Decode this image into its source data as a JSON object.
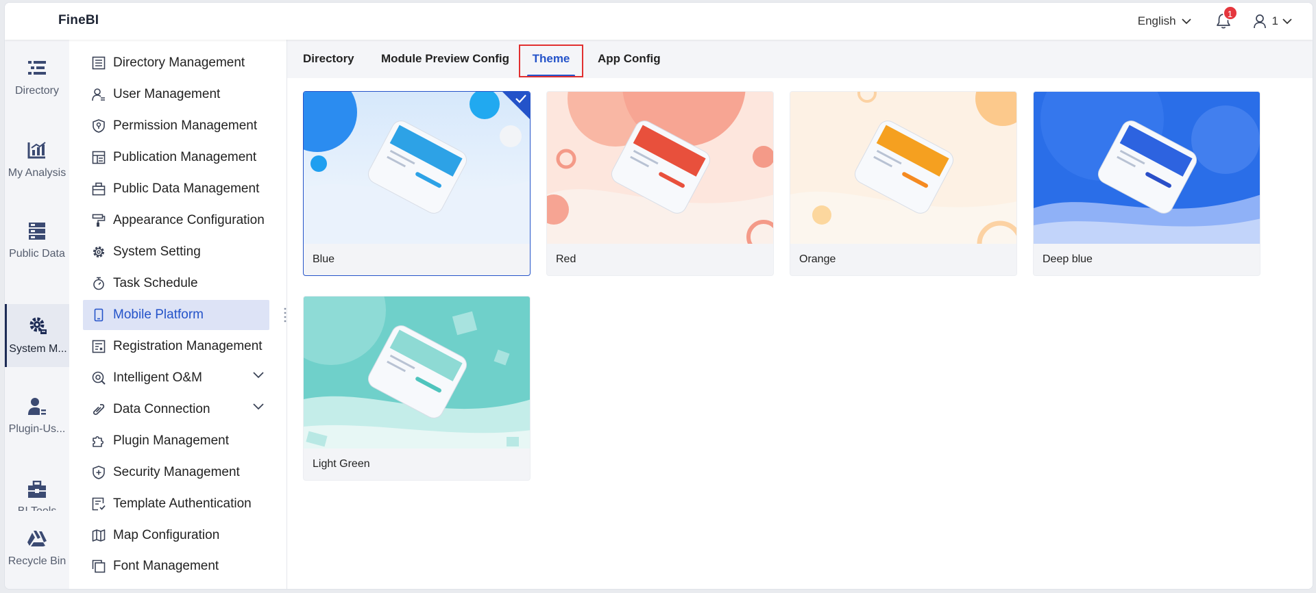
{
  "header": {
    "logo": "FineBI",
    "language": "English",
    "notification_count": "1",
    "user": "1"
  },
  "rail": {
    "items": [
      {
        "label": "Directory",
        "icon": "list-icon"
      },
      {
        "label": "My Analysis",
        "icon": "chart-icon"
      },
      {
        "label": "Public Data",
        "icon": "database-icon"
      },
      {
        "label": "System M...",
        "icon": "settings-gear-icon",
        "active": true
      },
      {
        "label": "Plugin-Us...",
        "icon": "user-icon"
      },
      {
        "label": "BI Tools",
        "icon": "toolbox-icon"
      },
      {
        "label": "Recycle Bin",
        "icon": "recycle-icon"
      }
    ]
  },
  "sidebar": {
    "items": [
      {
        "label": "Directory Management",
        "icon": "directory-icon"
      },
      {
        "label": "User Management",
        "icon": "user-management-icon"
      },
      {
        "label": "Permission Management",
        "icon": "permission-icon"
      },
      {
        "label": "Publication Management",
        "icon": "publication-icon"
      },
      {
        "label": "Public Data Management",
        "icon": "public-data-icon"
      },
      {
        "label": "Appearance Configuration",
        "icon": "paint-roller-icon"
      },
      {
        "label": "System Setting",
        "icon": "gear-icon"
      },
      {
        "label": "Task Schedule",
        "icon": "stopwatch-icon"
      },
      {
        "label": "Mobile Platform",
        "icon": "mobile-icon",
        "active": true
      },
      {
        "label": "Registration Management",
        "icon": "registration-icon"
      },
      {
        "label": "Intelligent O&M",
        "icon": "om-icon",
        "expandable": true
      },
      {
        "label": "Data Connection",
        "icon": "link-icon",
        "expandable": true
      },
      {
        "label": "Plugin Management",
        "icon": "puzzle-icon"
      },
      {
        "label": "Security Management",
        "icon": "shield-icon"
      },
      {
        "label": "Template Authentication",
        "icon": "template-icon"
      },
      {
        "label": "Map Configuration",
        "icon": "map-icon"
      },
      {
        "label": "Font Management",
        "icon": "font-icon"
      }
    ]
  },
  "tabs": [
    {
      "label": "Directory"
    },
    {
      "label": "Module Preview Config"
    },
    {
      "label": "Theme",
      "active": true
    },
    {
      "label": "App Config"
    }
  ],
  "themes": [
    {
      "name": "Blue",
      "selected": true,
      "accent": "#3a9ee8",
      "bg": "#e3eefb"
    },
    {
      "name": "Red",
      "accent": "#e8503c",
      "bg": "#fde4dc"
    },
    {
      "name": "Orange",
      "accent": "#f5a020",
      "bg": "#fdf0e2"
    },
    {
      "name": "Deep blue",
      "accent": "#2d63e0",
      "bg": "#2a6ee8"
    },
    {
      "name": "Light Green",
      "accent": "#4fc4bd",
      "bg": "#7fd8d2"
    }
  ],
  "colors": {
    "primary": "#2453c9",
    "highlight": "#e12f2f",
    "badge": "#e5363d"
  }
}
